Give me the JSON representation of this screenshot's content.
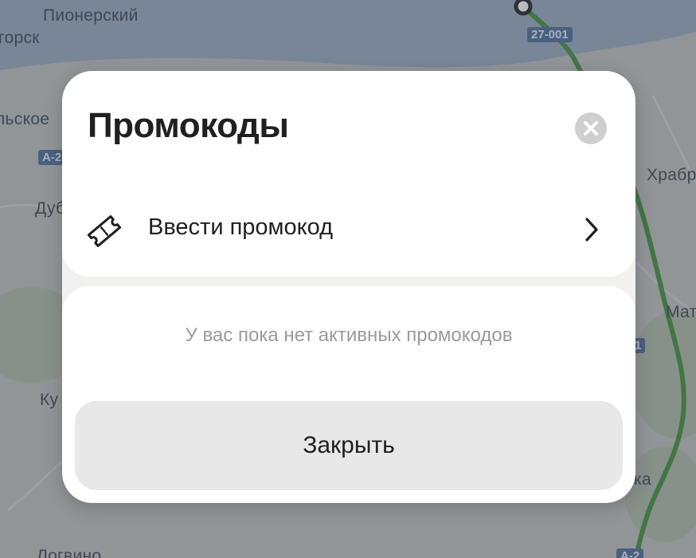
{
  "map": {
    "labels": [
      "Пионерский",
      "горск",
      "льское",
      "Дуб",
      "Ку",
      "Храбр",
      "Мат",
      "ка",
      "Логвино"
    ],
    "road_badges": [
      "27-001",
      "А-2",
      "1",
      "А-2"
    ]
  },
  "modal": {
    "title": "Промокоды",
    "close_icon": "close-icon",
    "promo_row": {
      "label": "Ввести промокод",
      "icon": "ticket-icon",
      "chevron": "chevron-right-icon"
    },
    "empty_text": "У вас пока нет активных промокодов",
    "close_button_label": "Закрыть"
  },
  "colors": {
    "title": "#21201f",
    "muted_text": "#9b9a97",
    "close_circle": "#cfcfcf",
    "button_bg": "#e8e8e8",
    "route": "#4f9a4b"
  }
}
